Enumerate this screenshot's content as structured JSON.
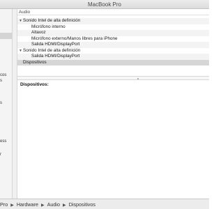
{
  "window": {
    "title": "MacBook Pro"
  },
  "sidebar": {
    "items": [
      {
        "label": "",
        "selected": true
      },
      {
        "label": "cos"
      },
      {
        "label": "s"
      },
      {
        "label": "s"
      },
      {
        "label": "ess"
      },
      {
        "label": "r"
      }
    ]
  },
  "tree": {
    "header": "Audio",
    "rows": [
      {
        "label": "Sonido Intel de alta definición",
        "level": 0,
        "expandable": true
      },
      {
        "label": "Micrófono interno",
        "level": 1
      },
      {
        "label": "Altavoz",
        "level": 1
      },
      {
        "label": "Micrófono externo/Manos libres para iPhone",
        "level": 1
      },
      {
        "label": "Salida HDMI/DisplayPort",
        "level": 1
      },
      {
        "label": "Sonido Intel de alta definición",
        "level": 0,
        "expandable": true
      },
      {
        "label": "Salida HDMI/DisplayPort",
        "level": 1
      },
      {
        "label": "Dispositivos",
        "level": 0,
        "selected": true
      }
    ],
    "expand_icon": "triangle-down-icon"
  },
  "detail": {
    "title": "Dispositivos:"
  },
  "pathbar": {
    "crumbs": [
      "Pro",
      "Hardware",
      "Audio",
      "Dispositivos"
    ],
    "separator_icon": "chevron-right-icon"
  }
}
